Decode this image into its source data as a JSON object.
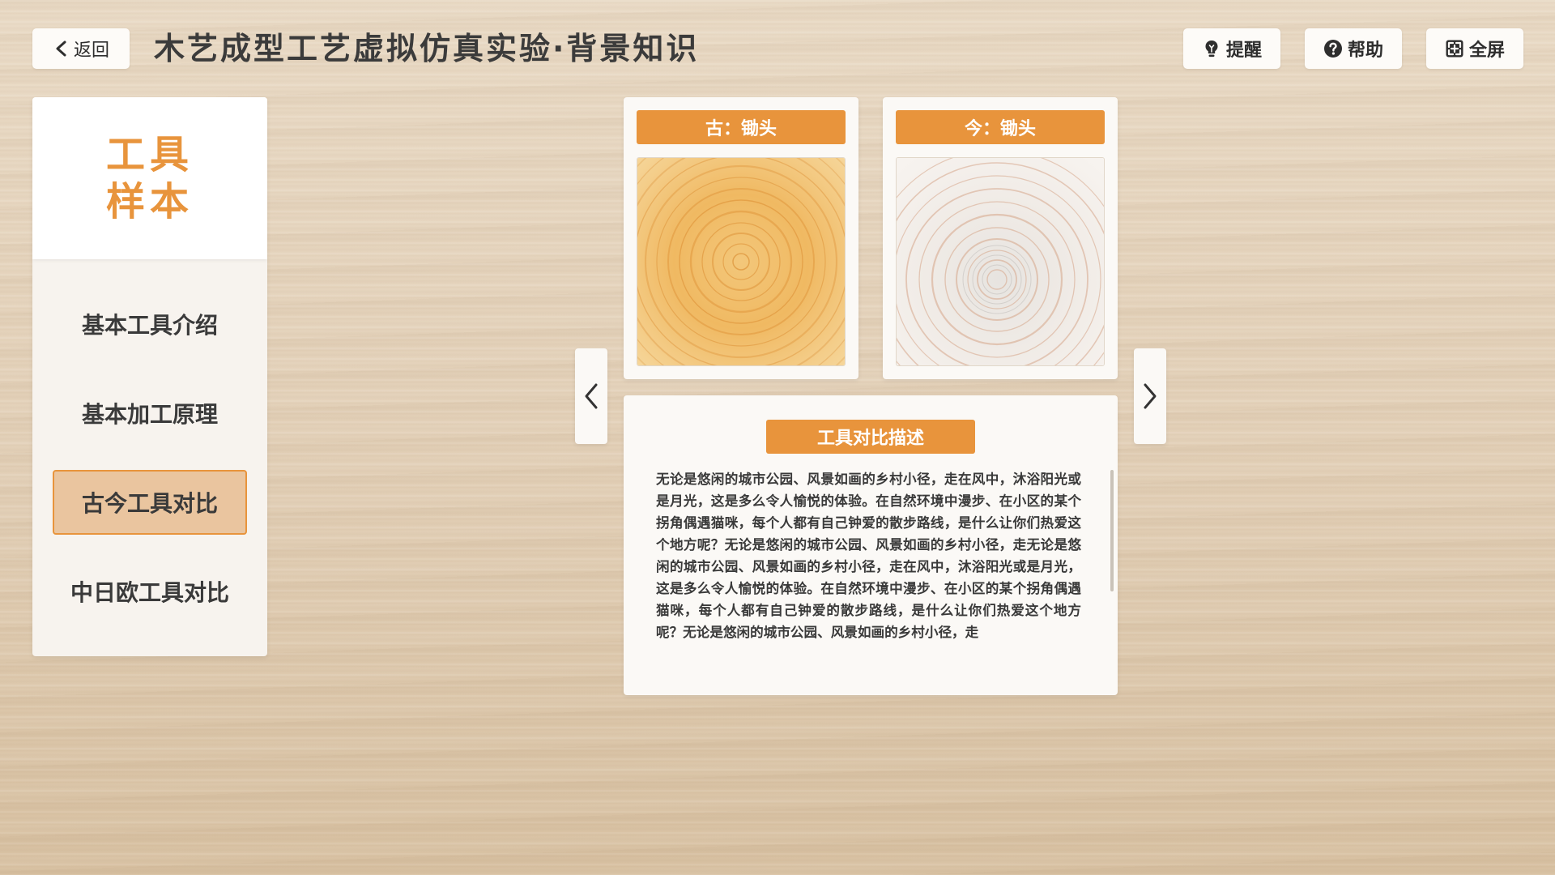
{
  "header": {
    "back_label": "返回",
    "title": "木艺成型工艺虚拟仿真实验·背景知识",
    "hint_label": "提醒",
    "help_label": "帮助",
    "fullscreen_label": "全屏"
  },
  "sidebar": {
    "title": "工具样本",
    "items": [
      {
        "label": "基本工具介绍",
        "active": false
      },
      {
        "label": "基本加工原理",
        "active": false
      },
      {
        "label": "古今工具对比",
        "active": true
      },
      {
        "label": "中日欧工具对比",
        "active": false
      }
    ]
  },
  "compare": {
    "old_label": "古：锄头",
    "new_label": "今：锄头",
    "desc_title": "工具对比描述",
    "desc_text": "无论是悠闲的城市公园、风景如画的乡村小径，走在风中，沐浴阳光或是月光，这是多么令人愉悦的体验。在自然环境中漫步、在小区的某个拐角偶遇猫咪，每个人都有自己钟爱的散步路线，是什么让你们热爱这个地方呢？无论是悠闲的城市公园、风景如画的乡村小径，走无论是悠闲的城市公园、风景如画的乡村小径，走在风中，沐浴阳光或是月光，这是多么令人愉悦的体验。在自然环境中漫步、在小区的某个拐角偶遇猫咪，每个人都有自己钟爱的散步路线，是什么让你们热爱这个地方呢？无论是悠闲的城市公园、风景如画的乡村小径，走"
  },
  "colors": {
    "accent": "#e8943c",
    "active_bg": "#eac59f"
  },
  "icons": [
    "chevron-left-icon",
    "bulb-icon",
    "question-icon",
    "fullscreen-icon",
    "arrow-left-icon",
    "arrow-right-icon"
  ]
}
